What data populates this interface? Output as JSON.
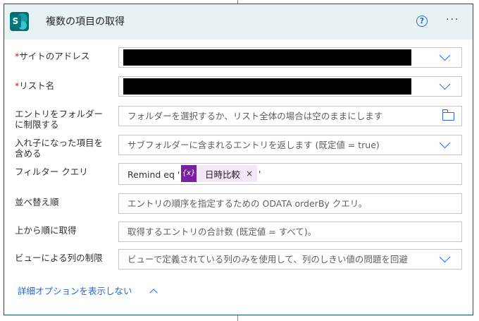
{
  "header": {
    "title": "複数の項目の取得",
    "help_icon": "?",
    "more_icon": "···"
  },
  "fields": [
    {
      "label_lines": [
        "サイトのアドレス"
      ],
      "required": true,
      "value_redacted": true,
      "trailing_icon": "chevron-down"
    },
    {
      "label_lines": [
        "リスト名"
      ],
      "required": true,
      "value_redacted": true,
      "trailing_icon": "chevron-down"
    },
    {
      "label_lines": [
        "エントリをフォルダー",
        "に制限する"
      ],
      "required": false,
      "placeholder": "フォルダーを選択するか、リスト全体の場合は空のままにします",
      "trailing_icon": "folder"
    },
    {
      "label_lines": [
        "入れ子になった項目を",
        "含める"
      ],
      "required": false,
      "placeholder": "サブフォルダーに含まれるエントリを返します (既定値 = true)",
      "trailing_icon": "chevron-down"
    },
    {
      "label_lines": [
        "フィルター クエリ"
      ],
      "required": false,
      "value_prefix": "Remind eq '",
      "token_icon": "{x}",
      "token_label": "日時比較",
      "token_close": "×",
      "value_suffix": "'"
    },
    {
      "label_lines": [
        "並べ替え順"
      ],
      "required": false,
      "placeholder": "エントリの順序を指定するための ODATA orderBy クエリ。"
    },
    {
      "label_lines": [
        "上から順に取得"
      ],
      "required": false,
      "placeholder": "取得するエントリの合計数 (既定値 = すべて)。"
    },
    {
      "label_lines": [
        "ビューによる列の制限"
      ],
      "required": false,
      "placeholder": "ビューで定義されている列のみを使用して、列のしきい値の問題を回避",
      "trailing_icon": "chevron-down"
    }
  ],
  "required_mark": "*",
  "advanced_toggle": "詳細オプションを表示しない",
  "colors": {
    "accent": "#2266e3",
    "header_bg": "#e9f2f2",
    "border": "#0b5a5a",
    "token_bg": "#f2e6f7",
    "token_icon_bg": "#7a1fa2",
    "required": "#a4262c"
  }
}
